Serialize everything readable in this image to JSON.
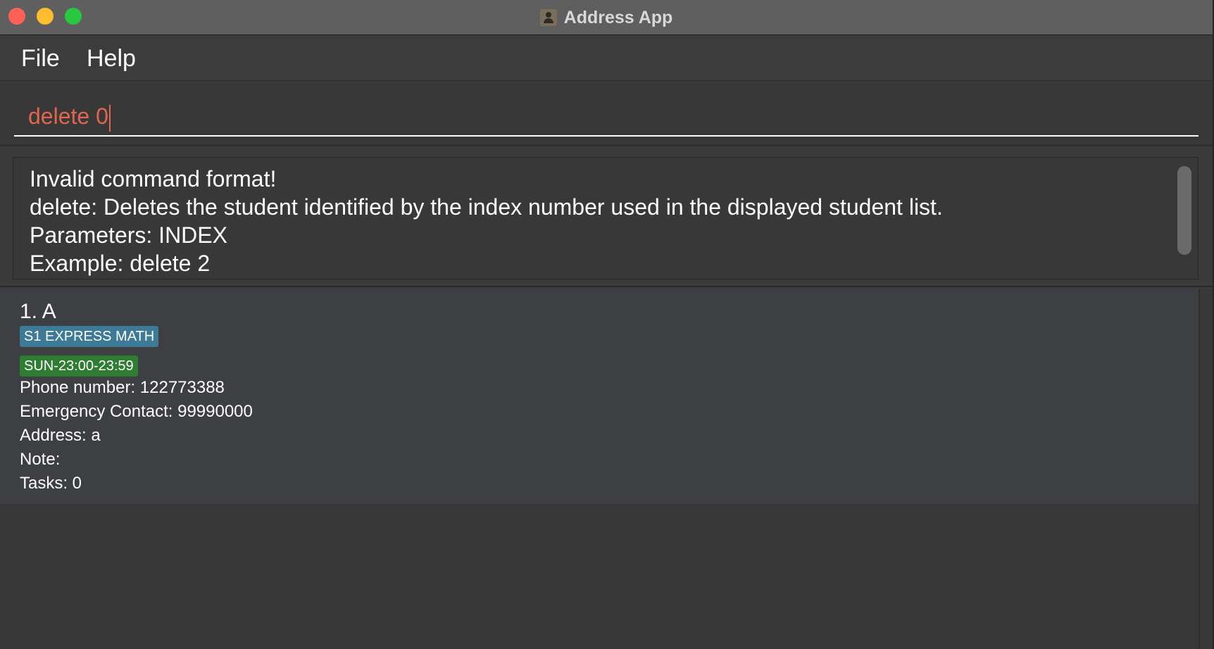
{
  "window": {
    "title": "Address App"
  },
  "menu": {
    "file_label": "File",
    "help_label": "Help"
  },
  "command_box": {
    "value": "delete 0"
  },
  "result_display": {
    "lines": [
      "Invalid command format!",
      "delete: Deletes the student identified by the index number used in the displayed student list.",
      "Parameters: INDEX",
      "Example: delete 2"
    ]
  },
  "students": [
    {
      "name": "1. A",
      "subject_tag": "S1 EXPRESS MATH",
      "schedule_tag": "SUN-23:00-23:59",
      "phone": "Phone number: 122773388",
      "emergency_contact": "Emergency Contact: 99990000",
      "address": "Address: a",
      "note": "Note:",
      "tasks": "Tasks: 0"
    }
  ],
  "colors": {
    "command_text": "#e06650",
    "subject_tag": "#3c7a97",
    "schedule_tag": "#2e7d32",
    "close_button": "#fe5f57",
    "minimize_button": "#febc2e",
    "maximize_button": "#28c840"
  },
  "icons": {
    "app": "contact-card-icon"
  }
}
